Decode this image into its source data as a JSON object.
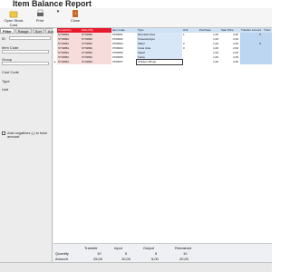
{
  "window": {
    "title": "Item Balance Report"
  },
  "toolbar": {
    "open_stock_card": "Open Stock Card",
    "print": "Print",
    "close": "Close"
  },
  "left_panel": {
    "tabs": [
      "Filter",
      "Range",
      "Sort",
      "Advanc"
    ],
    "labels": {
      "id": "ID",
      "item_code": "Item Code",
      "group": "Group",
      "cost_code": "Cost Code",
      "type": "Type",
      "unit": "Unit"
    },
    "checkbox_label": "Add negatives (-) to total amount",
    "filter_button": "Filter",
    "all_button": "All"
  },
  "grid": {
    "columns": [
      "Created by",
      "Edited By",
      "Item Code",
      "Type",
      "Unit",
      "Purchase",
      "Sale Price",
      "Transfer Amount",
      "Trans"
    ],
    "rows": [
      {
        "created": "SYSDBA",
        "edited": "SYSDBA",
        "code": "0700001",
        "type": "Mountain Dew",
        "unit": "1",
        "purchase": "1,00",
        "sale": "2,00",
        "transfer": "5",
        "marker": ""
      },
      {
        "created": "SYSDBA",
        "edited": "SYSDBA",
        "code": "0700002",
        "type": "Cheeseburger",
        "unit": "",
        "purchase": "1,00",
        "sale": "2,00",
        "transfer": "",
        "marker": ""
      },
      {
        "created": "SYSDBA",
        "edited": "SYSDBA",
        "code": "0700003",
        "type": "Water",
        "unit": "2",
        "purchase": "1,00",
        "sale": "2,00",
        "transfer": "5",
        "marker": ""
      },
      {
        "created": "SYSDBA",
        "edited": "SYSDBA",
        "code": "0700004",
        "type": "Coca Cola",
        "unit": "0",
        "purchase": "1,00",
        "sale": "2,00",
        "transfer": "",
        "marker": ""
      },
      {
        "created": "SYSDBA",
        "edited": "SYSDBA",
        "code": "0700005",
        "type": "Salad",
        "unit": "",
        "purchase": "1,00",
        "sale": "2,00",
        "transfer": "",
        "marker": ""
      },
      {
        "created": "SYSDBA",
        "edited": "SYSDBA",
        "code": "0700006",
        "type": "Fanta",
        "unit": "",
        "purchase": "1,00",
        "sale": "2,00",
        "transfer": "",
        "marker": ""
      },
      {
        "created": "SYSDBA",
        "edited": "SYSDBA",
        "code": "0700007",
        "type": "Chicken Wings",
        "unit": "",
        "purchase": "1,00",
        "sale": "2,00",
        "transfer": "",
        "marker": "▸"
      }
    ]
  },
  "footer": {
    "headers": [
      "Transfer",
      "Input",
      "Output",
      "Remained"
    ],
    "quantity_label": "Quantity",
    "amount_label": "Amount",
    "quantity_values": [
      "10",
      "5",
      "5",
      "10"
    ],
    "amount_values": [
      "25,00",
      "10,00",
      "5,00",
      "20,00"
    ]
  }
}
